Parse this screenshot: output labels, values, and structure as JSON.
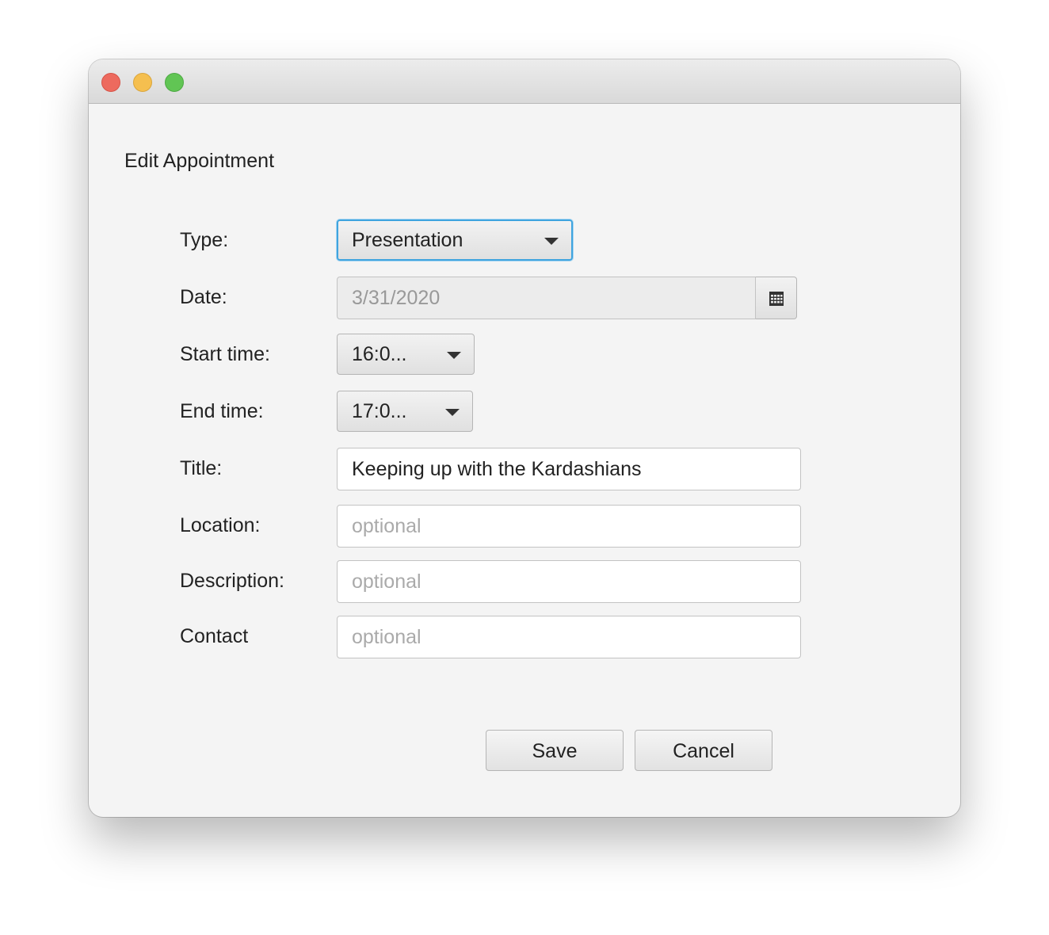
{
  "window": {
    "controls": [
      "close",
      "minimize",
      "zoom"
    ]
  },
  "form": {
    "heading": "Edit Appointment",
    "type": {
      "label": "Type:",
      "value": "Presentation"
    },
    "date": {
      "label": "Date:",
      "value": "3/31/2020",
      "icon": "calendar-icon"
    },
    "start_time": {
      "label": "Start time:",
      "value": "16:0..."
    },
    "end_time": {
      "label": "End time:",
      "value": "17:0..."
    },
    "title": {
      "label": "Title:",
      "value": "Keeping up with the Kardashians"
    },
    "location": {
      "label": "Location:",
      "placeholder": "optional",
      "value": ""
    },
    "description": {
      "label": "Description:",
      "placeholder": "optional",
      "value": ""
    },
    "contact": {
      "label": "Contact",
      "placeholder": "optional",
      "value": ""
    }
  },
  "buttons": {
    "save": "Save",
    "cancel": "Cancel"
  },
  "colors": {
    "focus_ring": "#3fa4df",
    "window_bg": "#f4f4f4",
    "close": "#ed6a5e",
    "minimize": "#f5bf4f",
    "zoom": "#61c554"
  }
}
